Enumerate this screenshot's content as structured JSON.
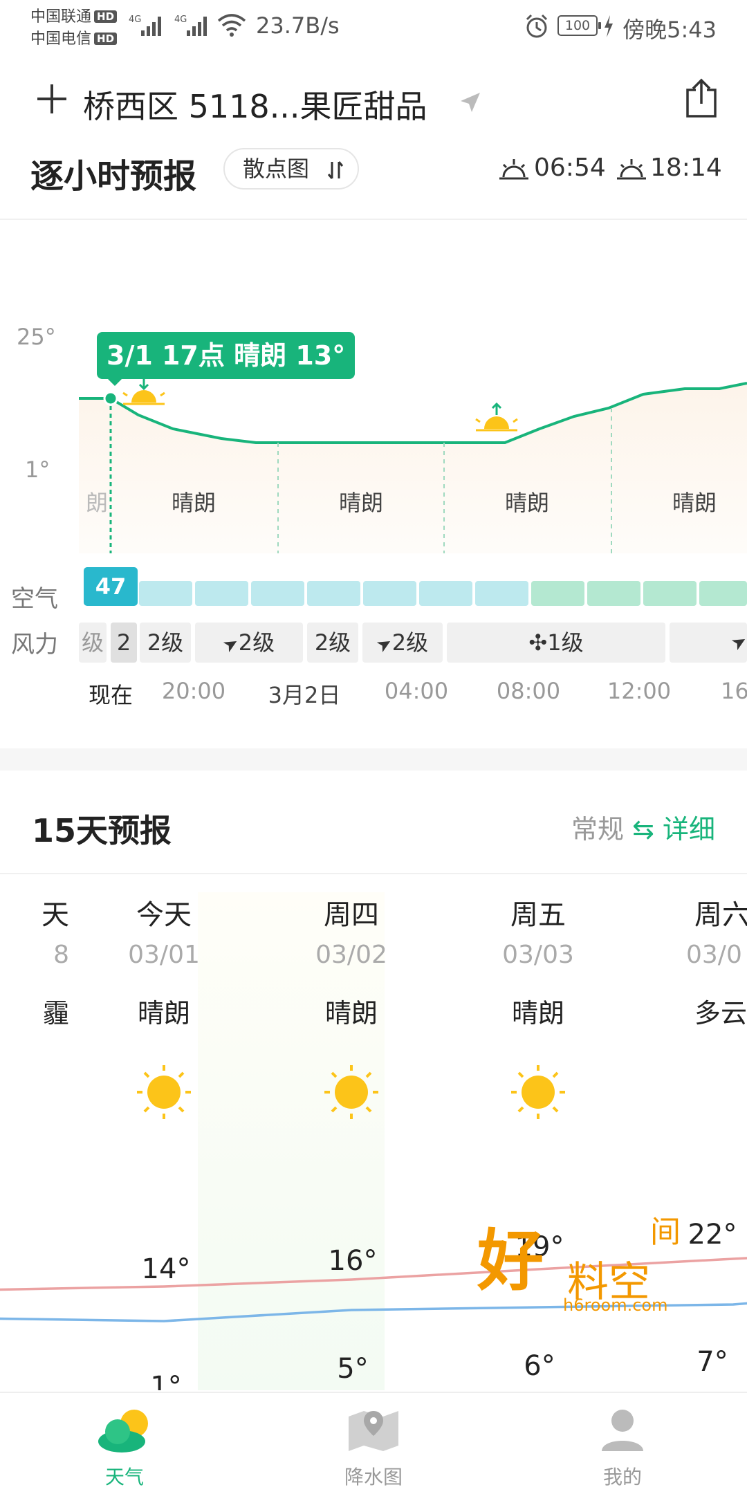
{
  "status_bar": {
    "carrier1": "中国联通",
    "carrier2": "中国电信",
    "hd": "HD",
    "net_speed": "23.7B/s",
    "battery": "100",
    "time": "傍晚5:43"
  },
  "header": {
    "location": "桥西区 5118...果匠甜品",
    "add_icon": "plus-icon",
    "share_icon": "share-icon"
  },
  "hourly": {
    "title": "逐小时预报",
    "mode_label": "散点图",
    "sunrise": "06:54",
    "sunset": "18:14",
    "axis_top": "25°",
    "axis_bottom": "1°",
    "tooltip": "3/1  17点  晴朗 13°",
    "conditions": [
      "朗",
      "晴朗",
      "晴朗",
      "晴朗",
      "晴朗"
    ],
    "rows": {
      "air": "空气",
      "wind": "风力"
    },
    "aqi_now": "47",
    "wind": [
      "级",
      "2",
      "2级",
      "2级",
      "2级",
      "2级",
      "1级"
    ],
    "times": [
      "现在",
      "20:00",
      "3月2日",
      "04:00",
      "08:00",
      "12:00",
      "16"
    ]
  },
  "forecast15": {
    "title": "15天预报",
    "toggle_off": "常规",
    "toggle_arrow": "⇆",
    "toggle_on": "详细",
    "days": [
      {
        "name": "天",
        "date": "8",
        "cond": "霾",
        "hi": "",
        "lo": ""
      },
      {
        "name": "今天",
        "date": "03/01",
        "cond": "晴朗",
        "hi": "14°",
        "lo": "1°"
      },
      {
        "name": "周四",
        "date": "03/02",
        "cond": "晴朗",
        "hi": "16°",
        "lo": "5°"
      },
      {
        "name": "周五",
        "date": "03/03",
        "cond": "晴朗",
        "hi": "19°",
        "lo": "6°"
      },
      {
        "name": "周六",
        "date": "03/0",
        "cond": "多云",
        "hi": "22°",
        "lo": "7°"
      }
    ],
    "hi_values": [
      13,
      14,
      16,
      19,
      22
    ],
    "lo_values": [
      2,
      1,
      5,
      6,
      7
    ]
  },
  "watermark": {
    "cn1": "好",
    "cn2": "料空",
    "cn3": "间",
    "url": "h6room.com"
  },
  "nav": {
    "weather": "天气",
    "rain_map": "降水图",
    "mine": "我的"
  },
  "colors": {
    "accent": "#18b47b",
    "hi_line": "#eba2a2",
    "lo_line": "#7cb6e8",
    "aqi_good": "#bde9ee",
    "aqi_green": "#b4e8d1"
  }
}
